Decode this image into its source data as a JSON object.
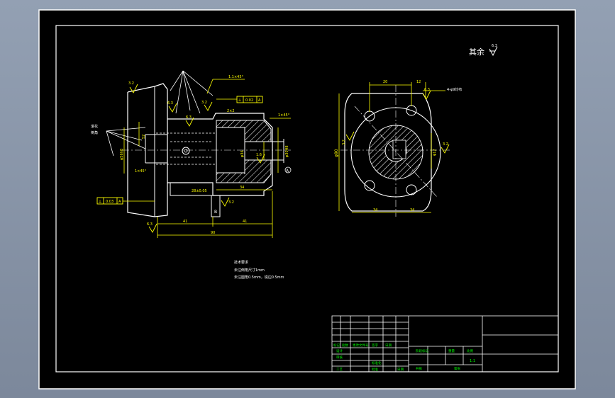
{
  "colors": {
    "background_outer": "#8793a6",
    "sheet": "#000000",
    "line": "#ffffff",
    "dimension": "#ffff00",
    "hatch": "#ffffff",
    "table_text": "#00ff00"
  },
  "sheet": {
    "roughness_rest_label": "其余",
    "roughness_rest_value": "6.3"
  },
  "left_view": {
    "roughness": [
      "3.2",
      "6.3",
      "6.3",
      "3.2",
      "1.6",
      "3.2",
      "6.3",
      "1.6"
    ],
    "chamfer_top": "1.1×45°",
    "chamfer_right": "1×45°",
    "chamfer_left": "1×45°",
    "groove": "2×2",
    "tolerance_top": [
      "⟂",
      "0.02",
      "A"
    ],
    "tolerance_bottom": [
      "⟂",
      "0.03",
      "A"
    ],
    "datum": "A",
    "datum_b": "B",
    "leader_note_1": "滚花",
    "leader_note_2": "倒角",
    "dims": {
      "overall_length": "90",
      "len_a": "41",
      "len_b": "41",
      "len_c": "34",
      "dia_left": "52",
      "dia_outer": "φ56h8",
      "dia_bore": "φ36",
      "dia_right": "φ30H8",
      "keyway": "28±0.05"
    }
  },
  "right_view": {
    "dims": {
      "top_a": "20",
      "top_b": "12",
      "bottom_a": "34",
      "bottom_b": "34",
      "height": "φ90",
      "hole": "φ12"
    },
    "hole_note": "4-φ9均布",
    "roughness": [
      "3.2",
      "6.3",
      "3.2"
    ]
  },
  "notes": {
    "heading": "技术要求",
    "line1": "未注倒角尺寸1mm",
    "line2": "未注圆角0.5mm，锐边0.5mm"
  },
  "title_block": {
    "rev_headers": [
      "标记",
      "处数",
      "更改文件号",
      "签字",
      "日期"
    ],
    "designer": "设计",
    "checker": "审核",
    "approver": "批准",
    "process": "工艺",
    "standard": "标准化",
    "stage_mark": "阶段标记",
    "weight": "重量",
    "scale": "比例",
    "scale_value": "1:1",
    "sheets_total": "共张",
    "sheet_no": "第张",
    "date": "日期"
  }
}
